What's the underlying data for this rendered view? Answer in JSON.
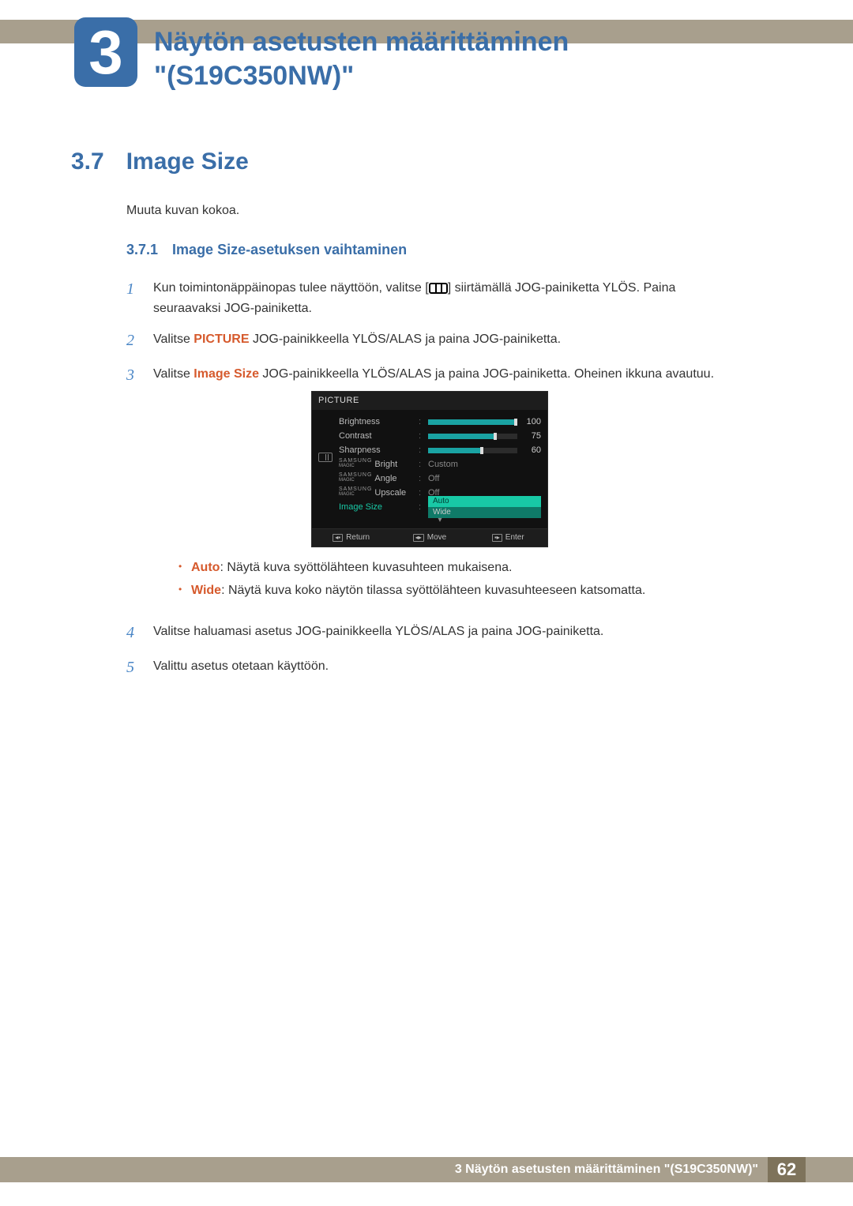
{
  "chapter": {
    "number": "3",
    "title_line1": "Näytön asetusten määrittäminen",
    "title_line2": "\"(S19C350NW)\""
  },
  "section": {
    "number": "3.7",
    "title": "Image Size",
    "intro": "Muuta kuvan kokoa."
  },
  "subsection": {
    "number": "3.7.1",
    "title": "Image Size-asetuksen vaihtaminen"
  },
  "steps": {
    "s1": {
      "num": "1",
      "before": "Kun toimintonäppäinopas tulee näyttöön, valitse [",
      "after": "] siirtämällä JOG-painiketta YLÖS. Paina seuraavaksi JOG-painiketta."
    },
    "s2": {
      "num": "2",
      "prefix": "Valitse ",
      "hl": "PICTURE",
      "suffix": " JOG-painikkeella YLÖS/ALAS ja paina JOG-painiketta."
    },
    "s3": {
      "num": "3",
      "prefix": "Valitse ",
      "hl": "Image Size",
      "suffix": " JOG-painikkeella YLÖS/ALAS ja paina JOG-painiketta. Oheinen ikkuna avautuu."
    },
    "s4": {
      "num": "4",
      "text": "Valitse haluamasi asetus JOG-painikkeella YLÖS/ALAS ja paina JOG-painiketta."
    },
    "s5": {
      "num": "5",
      "text": "Valittu asetus otetaan käyttöön."
    }
  },
  "bullets": {
    "auto": {
      "hl": "Auto",
      "text": ": Näytä kuva syöttölähteen kuvasuhteen mukaisena."
    },
    "wide": {
      "hl": "Wide",
      "text": ": Näytä kuva koko näytön tilassa syöttölähteen kuvasuhteeseen katsomatta."
    }
  },
  "osd": {
    "title": "PICTURE",
    "rows": {
      "brightness": {
        "label": "Brightness",
        "value": "100",
        "fill": 100
      },
      "contrast": {
        "label": "Contrast",
        "value": "75",
        "fill": 75
      },
      "sharpness": {
        "label": "Sharpness",
        "value": "60",
        "fill": 60
      },
      "bright": {
        "label": "Bright",
        "value": "Custom"
      },
      "angle": {
        "label": "Angle",
        "value": "Off"
      },
      "upscale": {
        "label": "Upscale",
        "value": "Off"
      },
      "imagesize": {
        "label": "Image Size"
      }
    },
    "dropdown": {
      "auto": "Auto",
      "wide": "Wide"
    },
    "footer": {
      "return": "Return",
      "move": "Move",
      "enter": "Enter"
    },
    "magic": {
      "top": "SAMSUNG",
      "bot": "MAGIC"
    }
  },
  "footer": {
    "text": "3 Näytön asetusten määrittäminen \"(S19C350NW)\"",
    "page": "62"
  }
}
